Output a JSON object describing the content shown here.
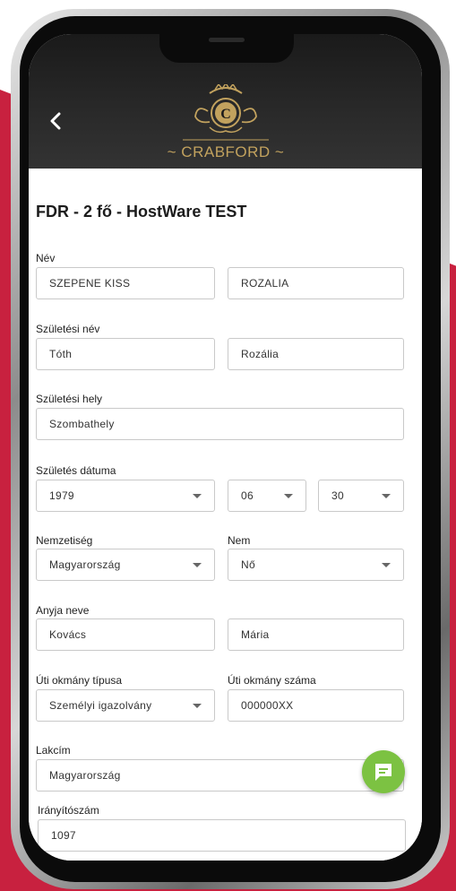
{
  "brand": {
    "name": "CRABFORD",
    "logo_letter": "C"
  },
  "header": {
    "back_icon": "chevron-left-icon"
  },
  "page": {
    "title": "FDR - 2 fő - HostWare TEST"
  },
  "form": {
    "name": {
      "label": "Név",
      "last": "SZEPENE KISS",
      "first": "ROZALIA"
    },
    "birth_name": {
      "label": "Születési név",
      "last": "Tóth",
      "first": "Rozália"
    },
    "birth_place": {
      "label": "Születési hely",
      "value": "Szombathely"
    },
    "birth_date": {
      "label": "Születés dátuma",
      "year": "1979",
      "month": "06",
      "day": "30"
    },
    "nationality": {
      "label": "Nemzetiség",
      "value": "Magyarország"
    },
    "gender": {
      "label": "Nem",
      "value": "Nő"
    },
    "mother_name": {
      "label": "Anyja neve",
      "last": "Kovács",
      "first": "Mária"
    },
    "doc_type": {
      "label": "Úti okmány típusa",
      "value": "Személyi igazolvány"
    },
    "doc_number": {
      "label": "Úti okmány száma",
      "value": "000000XX"
    },
    "address": {
      "label": "Lakcím",
      "value": "Magyarország"
    },
    "zip": {
      "label": "Irányítószám",
      "value": "1097"
    }
  },
  "colors": {
    "accent": "#c8213f",
    "fab": "#7cc242",
    "logo_gold": "#c2a25e"
  },
  "fab": {
    "icon": "chat-icon"
  }
}
